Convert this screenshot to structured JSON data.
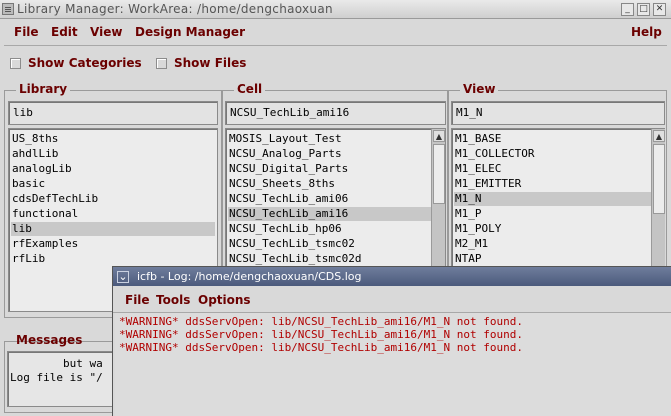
{
  "library_manager": {
    "title": "Library Manager: WorkArea:  /home/dengchaoxuan",
    "menu": {
      "file": "File",
      "edit": "Edit",
      "view": "View",
      "design_manager": "Design Manager",
      "help": "Help"
    },
    "show_categories": {
      "label": "Show Categories",
      "checked": false
    },
    "show_files": {
      "label": "Show Files",
      "checked": false
    },
    "library": {
      "title": "Library",
      "field": "lib",
      "items": [
        "US_8ths",
        "ahdlLib",
        "analogLib",
        "basic",
        "cdsDefTechLib",
        "functional",
        "lib",
        "rfExamples",
        "rfLib"
      ],
      "selected": "lib"
    },
    "cell": {
      "title": "Cell",
      "field": "NCSU_TechLib_ami16",
      "items": [
        "MOSIS_Layout_Test",
        "NCSU_Analog_Parts",
        "NCSU_Digital_Parts",
        "NCSU_Sheets_8ths",
        "NCSU_TechLib_ami06",
        "NCSU_TechLib_ami16",
        "NCSU_TechLib_hp06",
        "NCSU_TechLib_tsmc02",
        "NCSU_TechLib_tsmc02d"
      ],
      "selected": "NCSU_TechLib_ami16"
    },
    "view": {
      "title": "View",
      "field": "M1_N",
      "items": [
        "M1_BASE",
        "M1_COLLECTOR",
        "M1_ELEC",
        "M1_EMITTER",
        "M1_N",
        "M1_P",
        "M1_POLY",
        "M2_M1",
        "NTAP"
      ],
      "selected": "M1_N"
    },
    "messages": {
      "title": "Messages",
      "lines": [
        "        but wa",
        "Log file is \"/"
      ]
    }
  },
  "log_window": {
    "title": "icfb - Log: /home/dengchaoxuan/CDS.log",
    "menu": {
      "file": "File",
      "tools": "Tools",
      "options": "Options"
    },
    "lines": [
      "*WARNING* ddsServOpen: lib/NCSU_TechLib_ami16/M1_N not found.",
      "*WARNING* ddsServOpen: lib/NCSU_TechLib_ami16/M1_N not found.",
      "*WARNING* ddsServOpen: lib/NCSU_TechLib_ami16/M1_N not found."
    ]
  },
  "colors": {
    "menu_text": "#6b0000",
    "warning_text": "#b00000",
    "log_titlebar": "#4b5a7c",
    "selection": "#c8c8c8"
  },
  "icons": [
    "window-menu-icon",
    "minimize-icon",
    "maximize-icon",
    "close-icon",
    "window-chevron-icon",
    "scroll-up-icon",
    "scroll-down-icon"
  ]
}
